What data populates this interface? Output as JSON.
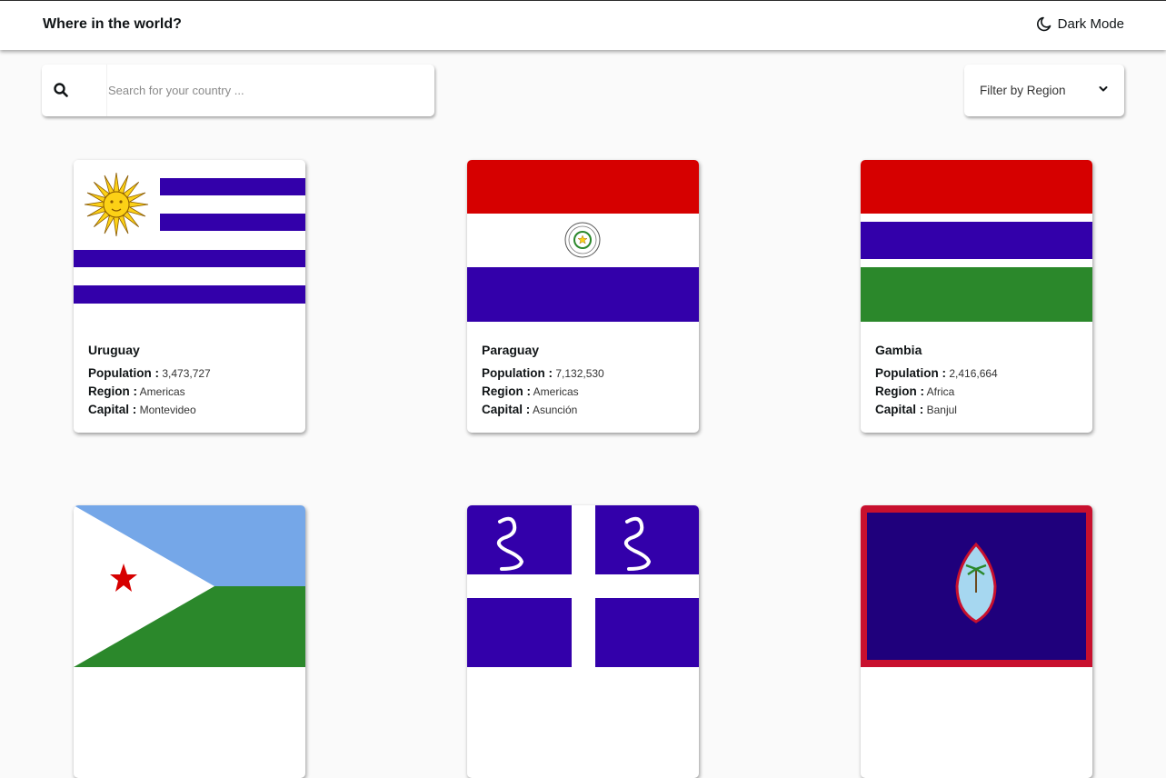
{
  "header": {
    "title": "Where in the world?",
    "dark_mode_label": "Dark Mode",
    "dark_mode_icon": "moon-icon"
  },
  "search": {
    "icon": "search-icon",
    "placeholder": "Search for your country ...",
    "value": ""
  },
  "filter": {
    "label": "Filter by Region",
    "icon": "chevron-down-icon"
  },
  "labels": {
    "population": "Population :",
    "region": "Region :",
    "capital": "Capital :"
  },
  "countries": [
    {
      "name": "Uruguay",
      "population": "3,473,727",
      "region": "Americas",
      "capital": "Montevideo"
    },
    {
      "name": "Paraguay",
      "population": "7,132,530",
      "region": "Americas",
      "capital": "Asunción"
    },
    {
      "name": "Gambia",
      "population": "2,416,664",
      "region": "Africa",
      "capital": "Banjul"
    }
  ],
  "colors": {
    "background": "#fafafa",
    "card": "#ffffff",
    "text": "#111517",
    "flag_blue": "#3300aa",
    "flag_red": "#d60000",
    "flag_green": "#2b882b",
    "sky_blue": "#75a7e8",
    "guam_navy": "#1f007c"
  }
}
